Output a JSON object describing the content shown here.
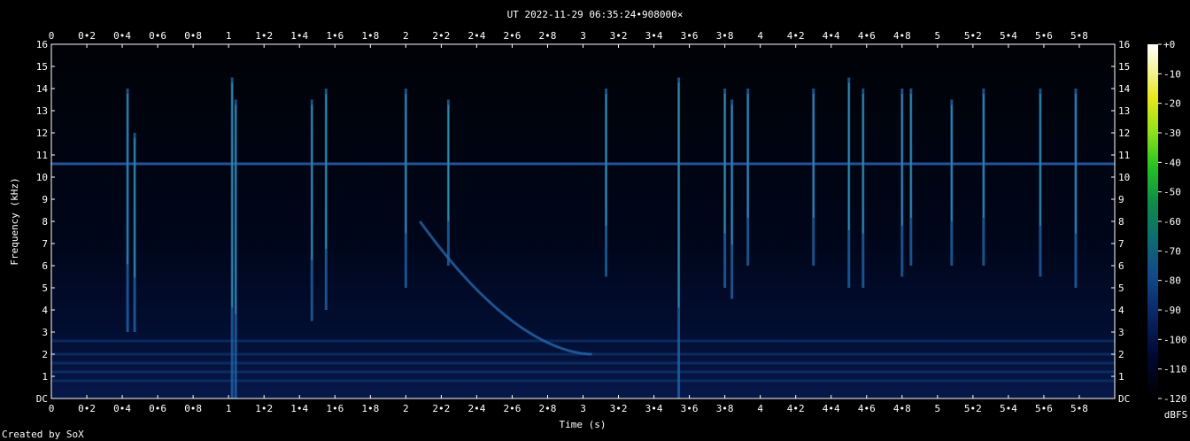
{
  "chart_data": {
    "type": "heatmap",
    "title": "UT 2022-11-29 06:35:24•908000×",
    "xlabel": "Time (s)",
    "ylabel": "Frequency (kHz)",
    "xlim": [
      0,
      6
    ],
    "ylim": [
      0,
      16
    ],
    "x_ticks": [
      "0",
      "0•2",
      "0•4",
      "0•6",
      "0•8",
      "1",
      "1•2",
      "1•4",
      "1•6",
      "1•8",
      "2",
      "2•2",
      "2•4",
      "2•6",
      "2•8",
      "3",
      "3•2",
      "3•4",
      "3•6",
      "3•8",
      "4",
      "4•2",
      "4•4",
      "4•6",
      "4•8",
      "5",
      "5•2",
      "5•4",
      "5•6",
      "5•8"
    ],
    "y_ticks": [
      "DC",
      "1",
      "2",
      "3",
      "4",
      "5",
      "6",
      "7",
      "8",
      "9",
      "10",
      "11",
      "12",
      "13",
      "14",
      "15",
      "16"
    ],
    "colorbar": {
      "label": "dBFS",
      "ticks": [
        "+0",
        "-10",
        "-20",
        "-30",
        "-40",
        "-50",
        "-60",
        "-70",
        "-80",
        "-90",
        "-100",
        "-110",
        "-120"
      ],
      "range": [
        -120,
        0
      ]
    },
    "footer": "Created by SoX",
    "features": {
      "horizontal_line_khz": 10.6,
      "low_bands_khz": [
        0.8,
        1.2,
        1.6,
        2.0,
        2.6
      ],
      "impulses": [
        {
          "t": 0.43,
          "top": 14.0,
          "bottom": 3.0
        },
        {
          "t": 0.47,
          "top": 12.0,
          "bottom": 3.0
        },
        {
          "t": 1.02,
          "top": 14.5,
          "bottom": 0.0
        },
        {
          "t": 1.04,
          "top": 13.5,
          "bottom": 0.0
        },
        {
          "t": 1.47,
          "top": 13.5,
          "bottom": 3.5
        },
        {
          "t": 1.55,
          "top": 14.0,
          "bottom": 4.0
        },
        {
          "t": 2.0,
          "top": 14.0,
          "bottom": 5.0
        },
        {
          "t": 2.24,
          "top": 13.5,
          "bottom": 6.0
        },
        {
          "t": 3.13,
          "top": 14.0,
          "bottom": 5.5
        },
        {
          "t": 3.54,
          "top": 14.5,
          "bottom": 0.0
        },
        {
          "t": 3.8,
          "top": 14.0,
          "bottom": 5.0
        },
        {
          "t": 3.84,
          "top": 13.5,
          "bottom": 4.5
        },
        {
          "t": 3.93,
          "top": 14.0,
          "bottom": 6.0
        },
        {
          "t": 4.3,
          "top": 14.0,
          "bottom": 6.0
        },
        {
          "t": 4.5,
          "top": 14.5,
          "bottom": 5.0
        },
        {
          "t": 4.58,
          "top": 14.0,
          "bottom": 5.0
        },
        {
          "t": 4.8,
          "top": 14.0,
          "bottom": 5.5
        },
        {
          "t": 4.85,
          "top": 14.0,
          "bottom": 6.0
        },
        {
          "t": 5.08,
          "top": 13.5,
          "bottom": 6.0
        },
        {
          "t": 5.26,
          "top": 14.0,
          "bottom": 6.0
        },
        {
          "t": 5.58,
          "top": 14.0,
          "bottom": 5.5
        },
        {
          "t": 5.78,
          "top": 14.0,
          "bottom": 5.0
        }
      ],
      "sweep": {
        "start_t": 2.08,
        "end_t": 3.05,
        "start_khz": 8.0,
        "end_khz": 2.0
      }
    }
  }
}
